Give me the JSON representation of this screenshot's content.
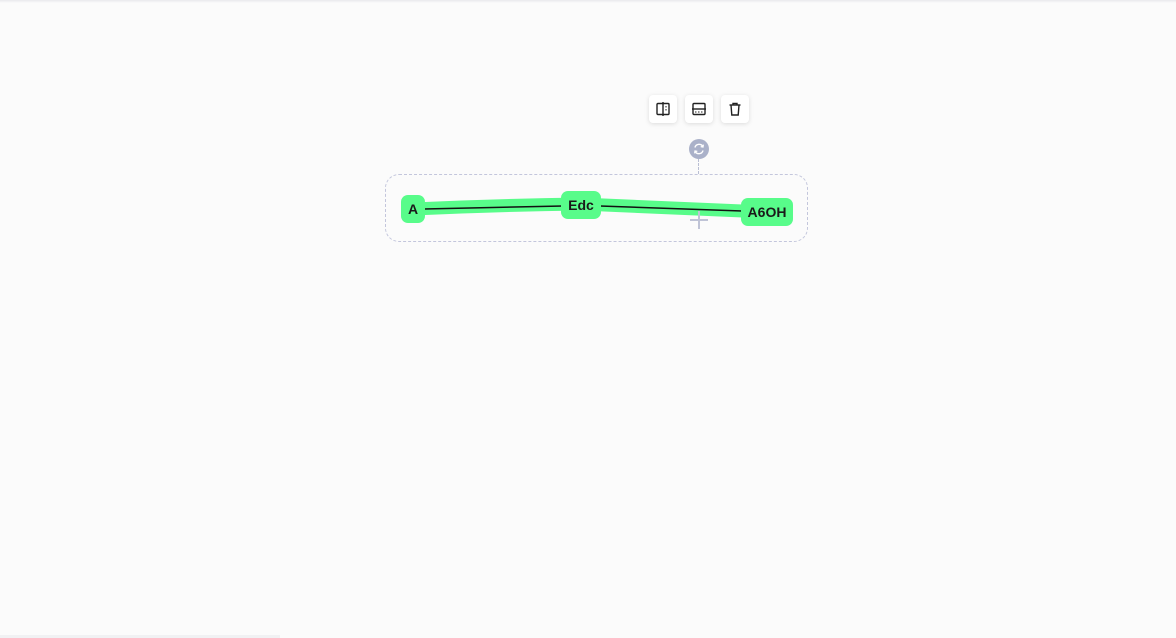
{
  "toolbar": {
    "buttons": [
      {
        "name": "split-vertical",
        "icon": "split-vertical-icon"
      },
      {
        "name": "split-horizontal",
        "icon": "split-horizontal-icon"
      },
      {
        "name": "delete",
        "icon": "trash-icon"
      }
    ]
  },
  "handles": {
    "rotate_icon": "rotate-icon",
    "move_icon": "move-crosshair-icon"
  },
  "diagram": {
    "nodes": [
      {
        "id": "a",
        "label": "A"
      },
      {
        "id": "edc",
        "label": "Edc"
      },
      {
        "id": "a6oh",
        "label": "A6OH"
      }
    ],
    "edges": [
      {
        "from": "a",
        "to": "edc"
      },
      {
        "from": "edc",
        "to": "a6oh"
      }
    ],
    "colors": {
      "node_fill": "#58fc8a",
      "highlight": "#58fc8a",
      "edge": "#111111",
      "selection_border": "#c3c6dc",
      "handle": "#aab1c9"
    }
  }
}
